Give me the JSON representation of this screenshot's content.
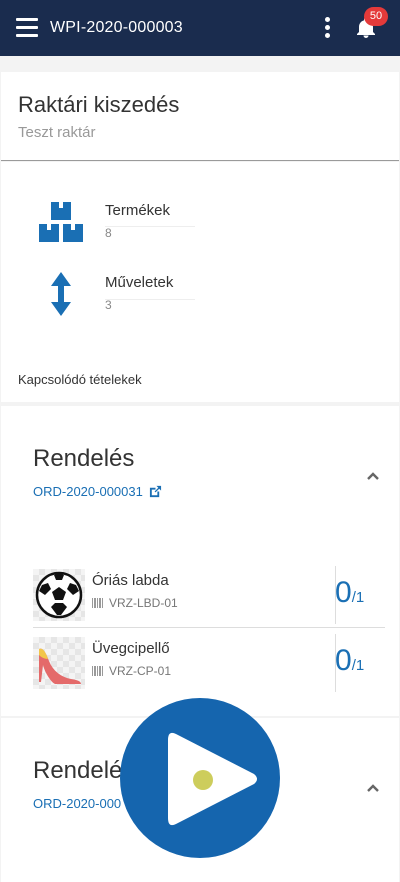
{
  "topbar": {
    "title": "WPI-2020-000003",
    "notifications": "50",
    "bg": "#1a2c4e"
  },
  "header": {
    "title": "Raktári kiszedés",
    "subtitle": "Teszt raktár"
  },
  "stats": [
    {
      "label": "Termékek",
      "value": "8",
      "icon": "boxes-icon"
    },
    {
      "label": "Műveletek",
      "value": "3",
      "icon": "arrows-vertical-icon"
    }
  ],
  "related": {
    "title": "Kapcsolódó tételekek"
  },
  "orders": [
    {
      "title": "Rendelés",
      "link": "ORD-2020-000031",
      "items": [
        {
          "name": "Óriás labda",
          "sku": "VRZ-LBD-01",
          "qty": "0",
          "total": "/1"
        },
        {
          "name": "Üvegcipellő",
          "sku": "VRZ-CP-01",
          "qty": "0",
          "total": "/1"
        }
      ]
    },
    {
      "title": "Rendelés",
      "link": "ORD-2020-000"
    }
  ],
  "colors": {
    "accent": "#1a6fb4",
    "play": "#1565ae",
    "badge": "#e43a3a"
  }
}
